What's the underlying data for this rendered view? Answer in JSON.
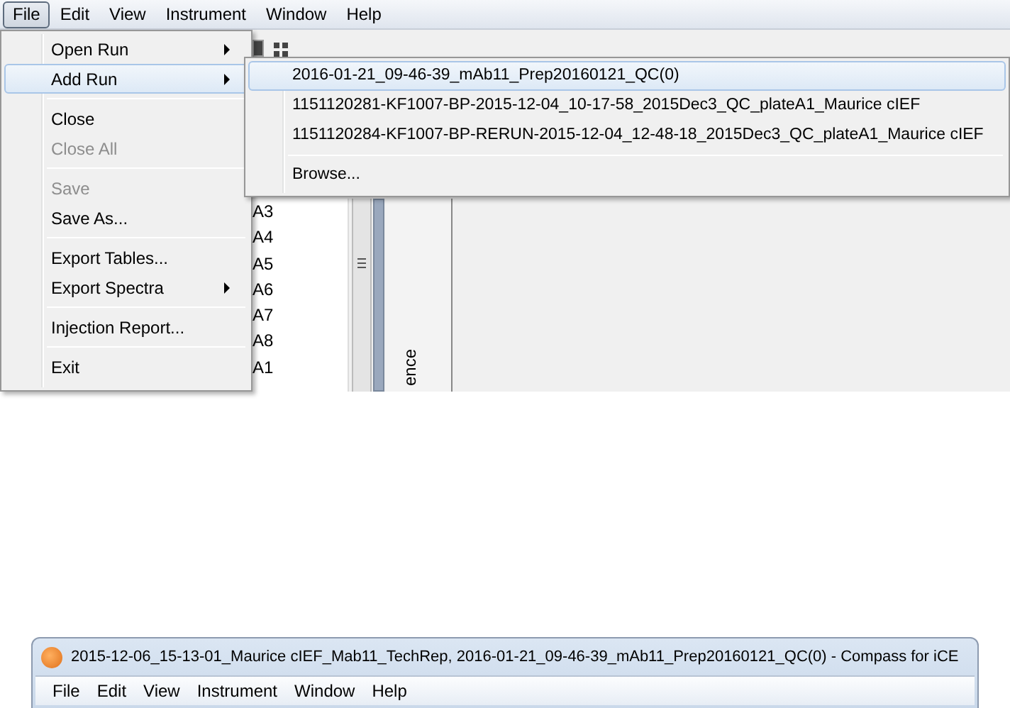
{
  "top_window": {
    "menu_bar": [
      {
        "label": "File",
        "selected": true
      },
      {
        "label": "Edit",
        "selected": false
      },
      {
        "label": "View",
        "selected": false
      },
      {
        "label": "Instrument",
        "selected": false
      },
      {
        "label": "Window",
        "selected": false
      },
      {
        "label": "Help",
        "selected": false
      }
    ],
    "well_list": [
      "A3",
      "A4",
      "A5",
      "A6",
      "A7",
      "A8",
      "A1"
    ],
    "vertical_tab": "ence",
    "file_menu": [
      [
        {
          "label": "Open Run",
          "submenu": true,
          "selected": false,
          "disabled": false
        },
        {
          "label": "Add Run",
          "submenu": true,
          "selected": true,
          "disabled": false
        }
      ],
      [
        {
          "label": "Close",
          "submenu": false,
          "selected": false,
          "disabled": false
        },
        {
          "label": "Close All",
          "submenu": false,
          "selected": false,
          "disabled": true
        }
      ],
      [
        {
          "label": "Save",
          "submenu": false,
          "selected": false,
          "disabled": true
        },
        {
          "label": "Save As...",
          "submenu": false,
          "selected": false,
          "disabled": false
        }
      ],
      [
        {
          "label": "Export Tables...",
          "submenu": false,
          "selected": false,
          "disabled": false
        },
        {
          "label": "Export Spectra",
          "submenu": true,
          "selected": false,
          "disabled": false
        }
      ],
      [
        {
          "label": "Injection Report...",
          "submenu": false,
          "selected": false,
          "disabled": false
        }
      ],
      [
        {
          "label": "Exit",
          "submenu": false,
          "selected": false,
          "disabled": false
        }
      ]
    ],
    "add_run_submenu": [
      [
        {
          "label": "2016-01-21_09-46-39_mAb11_Prep20160121_QC(0)",
          "selected": true
        },
        {
          "label": "1151120281-KF1007-BP-2015-12-04_10-17-58_2015Dec3_QC_plateA1_Maurice cIEF",
          "selected": false
        },
        {
          "label": "1151120284-KF1007-BP-RERUN-2015-12-04_12-48-18_2015Dec3_QC_plateA1_Maurice cIEF",
          "selected": false
        }
      ],
      [
        {
          "label": "Browse...",
          "selected": false
        }
      ]
    ]
  },
  "bottom_window": {
    "title": "2015-12-06_15-13-01_Maurice cIEF_Mab11_TechRep, 2016-01-21_09-46-39_mAb11_Prep20160121_QC(0) - Compass for iCE",
    "menu_bar": [
      {
        "label": "File",
        "selected": false
      },
      {
        "label": "Edit",
        "selected": false
      },
      {
        "label": "View",
        "selected": false
      },
      {
        "label": "Instrument",
        "selected": false
      },
      {
        "label": "Window",
        "selected": false
      },
      {
        "label": "Help",
        "selected": false
      }
    ]
  }
}
